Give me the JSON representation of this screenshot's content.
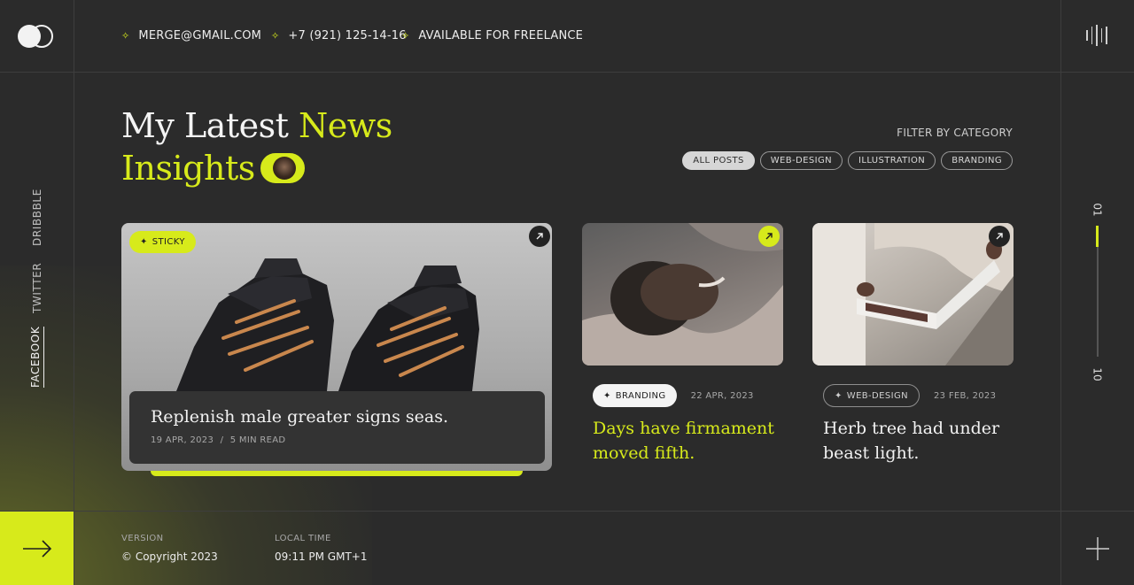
{
  "header": {
    "email": "MERGE@GMAIL.COM",
    "phone": "+7 (921) 125-14-16",
    "availability": "AVAILABLE FOR FREELANCE"
  },
  "social": [
    "DRIBBBLE",
    "TWITTER",
    "FACEBOOK"
  ],
  "title": {
    "line1_white": "My Latest",
    "line1_lime": "News",
    "line2_lime": "Insights"
  },
  "filter": {
    "label": "FILTER BY CATEGORY",
    "options": [
      "ALL POSTS",
      "WEB-DESIGN",
      "ILLUSTRATION",
      "BRANDING"
    ],
    "active": "ALL POSTS"
  },
  "pager": {
    "current": "01",
    "total": "10",
    "progress": 0.1
  },
  "posts": [
    {
      "badge": "STICKY",
      "title": "Replenish male greater signs seas.",
      "date": "19 APR, 2023",
      "separator": "/",
      "read_time": "5 MIN READ"
    },
    {
      "tag": "BRANDING",
      "date": "22 APR, 2023",
      "title": "Days have firmament moved fifth."
    },
    {
      "tag": "WEB-DESIGN",
      "date": "23 FEB, 2023",
      "title": "Herb tree had under beast light."
    }
  ],
  "footer": {
    "version_label": "VERSION",
    "version_value": "© Copyright 2023",
    "time_label": "LOCAL TIME",
    "time_value": "09:11 PM GMT+1"
  },
  "colors": {
    "accent": "#d7ea1b",
    "background": "#2b2b2b",
    "panel": "#333333"
  },
  "icons": [
    "logo-icon",
    "sparkle-icon",
    "sound-bars-icon",
    "arrow-up-right-icon",
    "arrow-right-icon",
    "plus-icon"
  ]
}
